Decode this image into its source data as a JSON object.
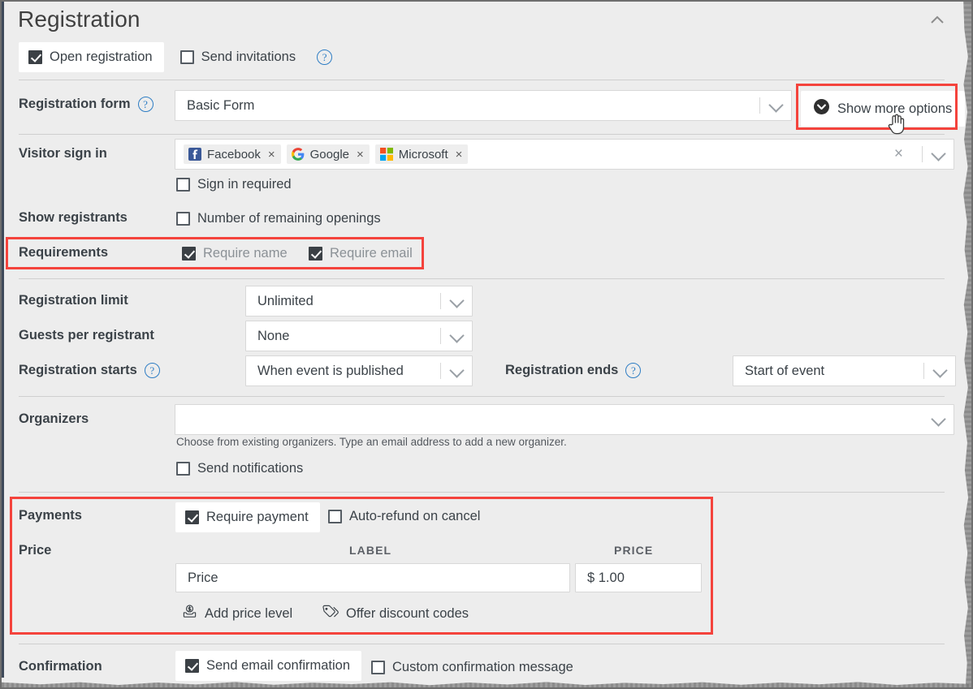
{
  "header": {
    "title": "Registration",
    "collapse_icon": "chevron-up-icon"
  },
  "top_toggles": {
    "open_registration": {
      "label": "Open registration",
      "checked": true
    },
    "send_invitations": {
      "label": "Send invitations",
      "checked": false
    },
    "help_icon": "question-mark-icon"
  },
  "registration_form": {
    "label": "Registration form",
    "help_icon": "question-mark-icon",
    "value": "Basic Form",
    "caret_icon": "chevron-down-icon"
  },
  "show_more_options": {
    "label": "Show more options",
    "icon": "chevron-down-circle-icon",
    "cursor": "pointer-hand-cursor"
  },
  "visitor_sign_in": {
    "label": "Visitor sign in",
    "providers": [
      {
        "name": "Facebook",
        "icon": "facebook-icon",
        "remove_icon": "remove-x-icon"
      },
      {
        "name": "Google",
        "icon": "google-icon",
        "remove_icon": "remove-x-icon"
      },
      {
        "name": "Microsoft",
        "icon": "microsoft-icon",
        "remove_icon": "remove-x-icon"
      }
    ],
    "clear_icon": "clear-x-icon",
    "caret_icon": "chevron-down-icon",
    "sign_in_required": {
      "label": "Sign in required",
      "checked": false
    }
  },
  "show_registrants": {
    "label": "Show registrants",
    "remaining_openings": {
      "label": "Number of remaining openings",
      "checked": false
    }
  },
  "requirements": {
    "label": "Requirements",
    "require_name": {
      "label": "Require name",
      "checked": true,
      "disabled": true
    },
    "require_email": {
      "label": "Require email",
      "checked": true,
      "disabled": true
    }
  },
  "registration_limit": {
    "label": "Registration limit",
    "value": "Unlimited",
    "caret_icon": "chevron-down-icon"
  },
  "guests_per_registrant": {
    "label": "Guests per registrant",
    "value": "None",
    "caret_icon": "chevron-down-icon"
  },
  "registration_starts": {
    "label": "Registration starts",
    "help_icon": "question-mark-icon",
    "value": "When event is published",
    "caret_icon": "chevron-down-icon"
  },
  "registration_ends": {
    "label": "Registration ends",
    "help_icon": "question-mark-icon",
    "value": "Start of event",
    "caret_icon": "chevron-down-icon"
  },
  "organizers": {
    "label": "Organizers",
    "value": "",
    "placeholder": "",
    "caret_icon": "chevron-down-icon",
    "hint": "Choose from existing organizers. Type an email address to add a new organizer.",
    "send_notifications": {
      "label": "Send notifications",
      "checked": false
    }
  },
  "payments": {
    "label": "Payments",
    "require_payment": {
      "label": "Require payment",
      "checked": true
    },
    "auto_refund": {
      "label": "Auto-refund on cancel",
      "checked": false
    }
  },
  "price": {
    "label": "Price",
    "columns": {
      "label_col": "LABEL",
      "price_col": "PRICE"
    },
    "rows": [
      {
        "label": "Price",
        "price": "$ 1.00"
      }
    ],
    "add_price_level": {
      "label": "Add price level",
      "icon": "money-tray-icon"
    },
    "offer_discount_codes": {
      "label": "Offer discount codes",
      "icon": "tag-icon"
    }
  },
  "confirmation": {
    "label": "Confirmation",
    "send_email_confirmation": {
      "label": "Send email confirmation",
      "checked": true
    },
    "custom_confirmation_message": {
      "label": "Custom confirmation message",
      "checked": false
    }
  },
  "colors": {
    "highlight": "#f4433c",
    "panel_bg": "#ededed",
    "accent_blue": "#2e7dc4",
    "text": "#3b4248",
    "disabled_text": "#8b9196"
  }
}
